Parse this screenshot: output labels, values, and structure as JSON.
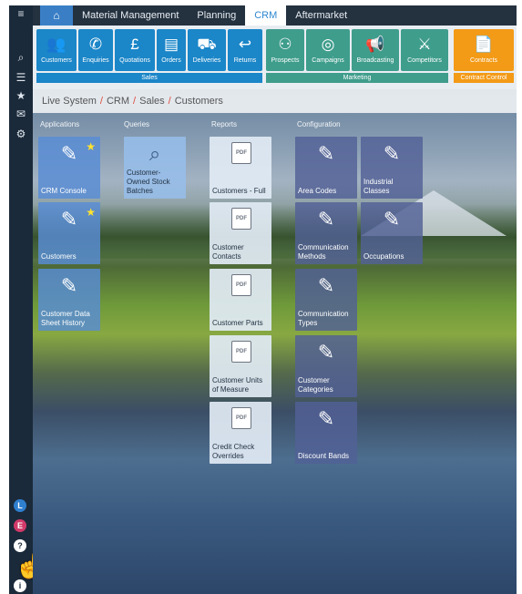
{
  "topbar": {
    "tabs": [
      {
        "label": "Material Management"
      },
      {
        "label": "Planning"
      },
      {
        "label": "CRM"
      },
      {
        "label": "Aftermarket"
      }
    ]
  },
  "ribbon": {
    "sales": [
      {
        "label": "Customers",
        "icon": "customers-icon"
      },
      {
        "label": "Enquiries",
        "icon": "phone-icon"
      },
      {
        "label": "Quotations",
        "icon": "pound-icon"
      },
      {
        "label": "Orders",
        "icon": "orders-icon"
      },
      {
        "label": "Deliveries",
        "icon": "truck-icon"
      },
      {
        "label": "Returns",
        "icon": "returns-icon"
      }
    ],
    "marketing": [
      {
        "label": "Prospects",
        "icon": "prospects-icon"
      },
      {
        "label": "Campaigns",
        "icon": "target-icon"
      },
      {
        "label": "Broadcasting",
        "icon": "megaphone-icon"
      },
      {
        "label": "Competitors",
        "icon": "competitors-icon"
      }
    ],
    "contracts": {
      "label": "Contracts",
      "icon": "contract-icon"
    },
    "groups": {
      "sales": "Sales",
      "marketing": "Marketing",
      "contract_control": "Contract Control"
    }
  },
  "breadcrumb": {
    "parts": [
      "Live System",
      "CRM",
      "Sales",
      "Customers"
    ]
  },
  "columns": {
    "applications": "Applications",
    "queries": "Queries",
    "reports": "Reports",
    "configuration": "Configuration"
  },
  "tiles": {
    "applications": [
      {
        "label": "CRM Console",
        "starred": true
      },
      {
        "label": "Customers",
        "starred": true
      },
      {
        "label": "Customer Data Sheet History",
        "starred": false
      }
    ],
    "queries": [
      {
        "label": "Customer-Owned Stock Batches"
      }
    ],
    "reports": [
      {
        "label": "Customers - Full"
      },
      {
        "label": "Customer Contacts"
      },
      {
        "label": "Customer Parts"
      },
      {
        "label": "Customer Units of Measure"
      },
      {
        "label": "Credit Check Overrides"
      }
    ],
    "configuration": [
      {
        "label": "Area Codes"
      },
      {
        "label": "Industrial Classes"
      },
      {
        "label": "Communication Methods"
      },
      {
        "label": "Occupations"
      },
      {
        "label": "Communication Types"
      },
      {
        "label": "Customer Categories"
      },
      {
        "label": "Discount Bands"
      }
    ]
  },
  "pdf_badge": "PDF",
  "rail": {
    "badge_l": "L",
    "badge_e": "E"
  },
  "colors": {
    "sales_blue": "#1b86c8",
    "marketing_teal": "#3f9d8c",
    "contracts_orange": "#f39a17",
    "active_tab": "#2f88d0"
  }
}
